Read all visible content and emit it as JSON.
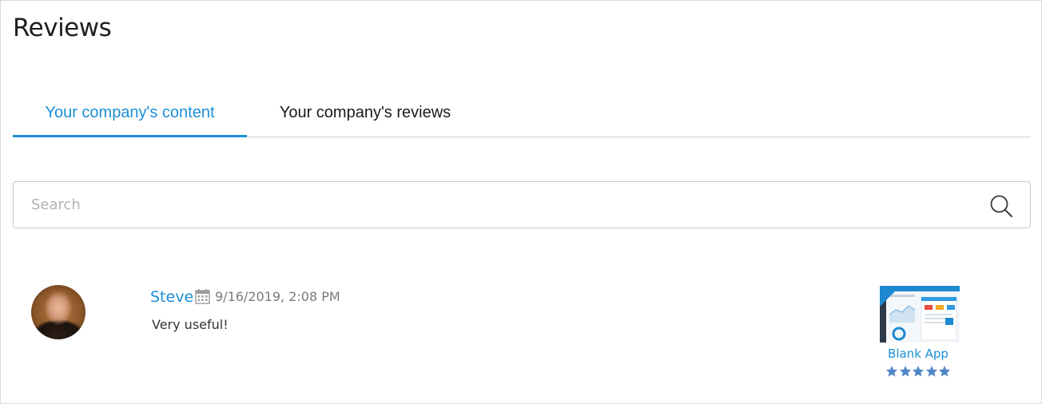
{
  "page": {
    "title": "Reviews"
  },
  "tabs": [
    {
      "label": "Your company's content",
      "active": true
    },
    {
      "label": "Your company's reviews",
      "active": false
    }
  ],
  "search": {
    "placeholder": "Search",
    "value": "",
    "icon": "search-icon"
  },
  "reviews": [
    {
      "reviewer": "Steve",
      "date": "9/16/2019, 2:08 PM",
      "date_icon": "calendar-icon",
      "text": "Very useful!",
      "app": {
        "name": "Blank App",
        "rating": 5,
        "rating_max": 5
      }
    }
  ],
  "colors": {
    "accent": "#1a8fd6",
    "star": "#4f86c6",
    "border": "#d0d0d0",
    "title": "#1f1f1f",
    "muted": "#7a7a7a"
  }
}
